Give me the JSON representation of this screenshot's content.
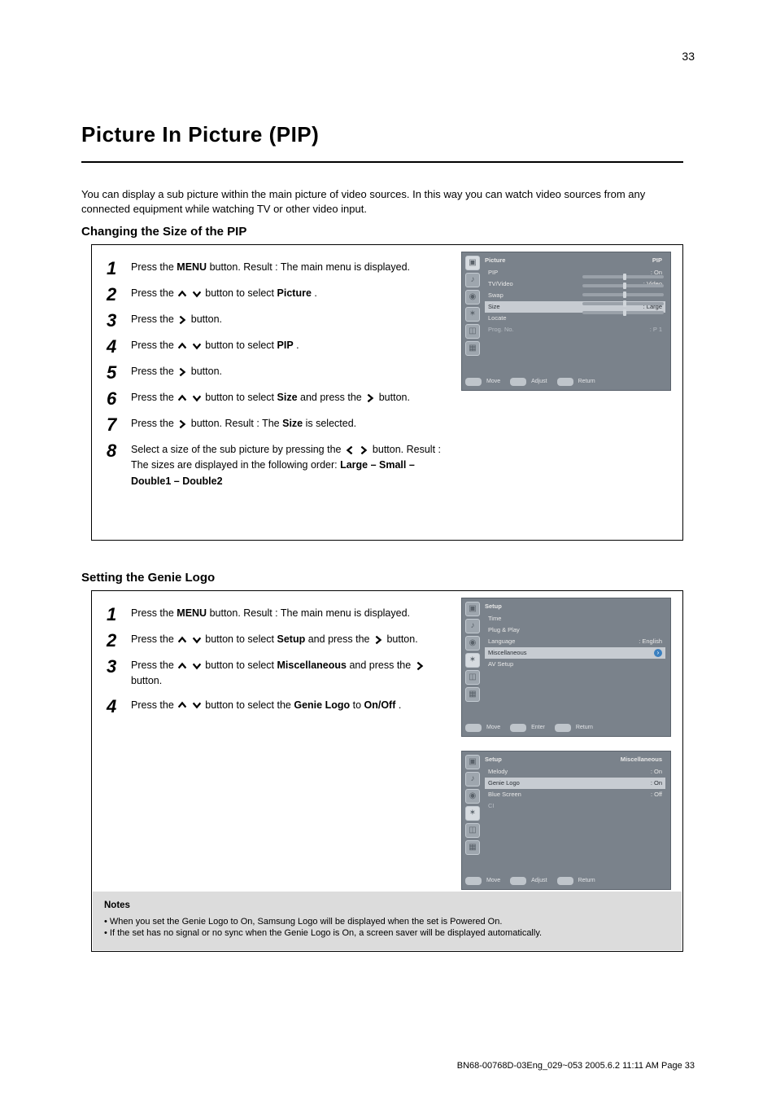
{
  "page": {
    "number_top": "33",
    "footer": "BN68-00768D-03Eng_029~053  2005.6.2  11:11 AM  Page 33"
  },
  "title": "Picture In Picture (PIP)",
  "intro": "You can display a sub picture within the main picture of video sources. In this way you can watch video sources from any connected equipment while watching TV or other video input.",
  "sub_pip": "Changing the Size of the PIP",
  "sub_logo": "Setting the Genie Logo",
  "pip_steps": [
    {
      "n": "1",
      "text_pre": "Press the ",
      "bold1": "MENU",
      "text_mid": " button. Result : The main menu is displayed."
    },
    {
      "n": "2",
      "text_a": "Press the ",
      "icons_a": [
        "up",
        "down"
      ],
      "text_b": " button to select ",
      "bold_b": "Picture",
      "text_c": "."
    },
    {
      "n": "3",
      "text_a": "Press the ",
      "icons_a": [
        "right"
      ],
      "text_b": " button. "
    },
    {
      "n": "4",
      "text_a": "Press the ",
      "icons_a": [
        "up",
        "down"
      ],
      "text_b": " button to select ",
      "bold_b": "PIP",
      "text_c": "."
    },
    {
      "n": "5",
      "text_a": "Press the ",
      "icons_a": [
        "right"
      ],
      "text_b": " button."
    },
    {
      "n": "6",
      "text_a": "Press the ",
      "icons_a": [
        "up",
        "down"
      ],
      "text_b": " button to select ",
      "bold_b": "Size",
      "text_c": " and press the ",
      "icons_c": [
        "right"
      ],
      "text_d": " button."
    },
    {
      "n": "7",
      "text_a": "Press the ",
      "icons_a": [
        "right"
      ],
      "text_b": " button.  Result : The ",
      "bold_b": "Size",
      "text_c": " is selected."
    },
    {
      "n": "8",
      "text_a": "Select a size of the sub picture by pressing the ",
      "icons_a": [
        "left",
        "right"
      ],
      "text_b": " button. Result : The sizes are displayed in the following order: ",
      "bold_b": "Large – Small – Double1 – Double2",
      "text_c": ""
    }
  ],
  "logo_steps": [
    {
      "n": "1",
      "text_pre": "Press the ",
      "bold1": "MENU",
      "text_mid": " button. Result : The main menu is displayed."
    },
    {
      "n": "2",
      "text_a": "Press the ",
      "icons_a": [
        "up",
        "down"
      ],
      "text_b": " button to select ",
      "bold_b": "Setup",
      "text_c": " and press the ",
      "icons_c": [
        "right"
      ],
      "text_d": " button."
    },
    {
      "n": "3",
      "text_a": "Press the ",
      "icons_a": [
        "up",
        "down"
      ],
      "text_b": " button to select ",
      "bold_b": "Miscellaneous",
      "text_c": " and press the ",
      "icons_c": [
        "right"
      ],
      "text_d": " button."
    },
    {
      "n": "4",
      "text_a": "Press the ",
      "icons_a": [
        "up",
        "down"
      ],
      "text_b": " button to select the ",
      "bold_b": "Genie Logo",
      "text_c": " to ",
      "bold_c2": "On/Off",
      "text_d": "."
    }
  ],
  "notes": {
    "title": "Notes",
    "line1": "When you set the Genie Logo to On, Samsung Logo will be displayed when the set is Powered On.",
    "line2": "If the set has no signal or no sync when the Genie Logo is On, a screen saver will be displayed automatically."
  },
  "osd_pip": {
    "title_left": "Picture",
    "title_right": "PIP",
    "rows": [
      {
        "label": "PIP",
        "val": ": On"
      },
      {
        "label": "TV/Video",
        "val": ": Video"
      },
      {
        "label": "Swap",
        "val": ""
      },
      {
        "label": "Size",
        "val": ": Large",
        "highlight": true
      },
      {
        "label": "Locate",
        "val": ""
      },
      {
        "label": "Prog. No.",
        "val": ": P 1",
        "subtle": true
      }
    ],
    "hints": [
      "Move",
      "Adjust",
      "Return"
    ]
  },
  "osd_setup": {
    "title_left": "Setup",
    "rows": [
      {
        "label": "Time",
        "val": ""
      },
      {
        "label": "Plug & Play",
        "val": ""
      },
      {
        "label": "Language",
        "val": ": English"
      },
      {
        "label": "Miscellaneous",
        "val": "",
        "highlight": true,
        "arrow": true
      },
      {
        "label": "AV Setup",
        "val": ""
      }
    ],
    "hints": [
      "Move",
      "Enter",
      "Return"
    ]
  },
  "osd_misc": {
    "title_left": "Setup",
    "title_right": "Miscellaneous",
    "rows": [
      {
        "label": "Melody",
        "val": ": On"
      },
      {
        "label": "Genie Logo",
        "val": ": On",
        "highlight": true
      },
      {
        "label": "Blue Screen",
        "val": ": Off"
      },
      {
        "label": "CI",
        "val": "",
        "subtle": true
      }
    ],
    "hints": [
      "Move",
      "Adjust",
      "Return"
    ]
  },
  "ui": {
    "move": "Move",
    "adjust": "Adjust",
    "enter": "Enter",
    "return": "Return"
  }
}
